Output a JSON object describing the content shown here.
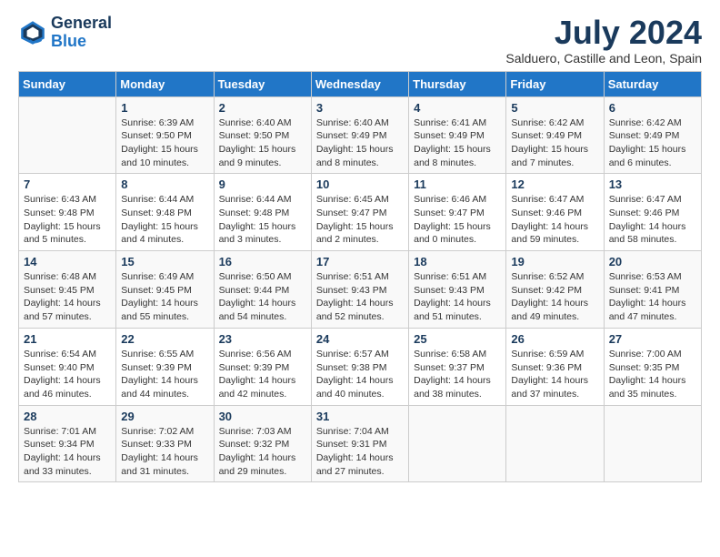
{
  "header": {
    "logo_line1": "General",
    "logo_line2": "Blue",
    "month_title": "July 2024",
    "location": "Salduero, Castille and Leon, Spain"
  },
  "days_of_week": [
    "Sunday",
    "Monday",
    "Tuesday",
    "Wednesday",
    "Thursday",
    "Friday",
    "Saturday"
  ],
  "weeks": [
    [
      {
        "day": "",
        "info": ""
      },
      {
        "day": "1",
        "info": "Sunrise: 6:39 AM\nSunset: 9:50 PM\nDaylight: 15 hours\nand 10 minutes."
      },
      {
        "day": "2",
        "info": "Sunrise: 6:40 AM\nSunset: 9:50 PM\nDaylight: 15 hours\nand 9 minutes."
      },
      {
        "day": "3",
        "info": "Sunrise: 6:40 AM\nSunset: 9:49 PM\nDaylight: 15 hours\nand 8 minutes."
      },
      {
        "day": "4",
        "info": "Sunrise: 6:41 AM\nSunset: 9:49 PM\nDaylight: 15 hours\nand 8 minutes."
      },
      {
        "day": "5",
        "info": "Sunrise: 6:42 AM\nSunset: 9:49 PM\nDaylight: 15 hours\nand 7 minutes."
      },
      {
        "day": "6",
        "info": "Sunrise: 6:42 AM\nSunset: 9:49 PM\nDaylight: 15 hours\nand 6 minutes."
      }
    ],
    [
      {
        "day": "7",
        "info": "Sunrise: 6:43 AM\nSunset: 9:48 PM\nDaylight: 15 hours\nand 5 minutes."
      },
      {
        "day": "8",
        "info": "Sunrise: 6:44 AM\nSunset: 9:48 PM\nDaylight: 15 hours\nand 4 minutes."
      },
      {
        "day": "9",
        "info": "Sunrise: 6:44 AM\nSunset: 9:48 PM\nDaylight: 15 hours\nand 3 minutes."
      },
      {
        "day": "10",
        "info": "Sunrise: 6:45 AM\nSunset: 9:47 PM\nDaylight: 15 hours\nand 2 minutes."
      },
      {
        "day": "11",
        "info": "Sunrise: 6:46 AM\nSunset: 9:47 PM\nDaylight: 15 hours\nand 0 minutes."
      },
      {
        "day": "12",
        "info": "Sunrise: 6:47 AM\nSunset: 9:46 PM\nDaylight: 14 hours\nand 59 minutes."
      },
      {
        "day": "13",
        "info": "Sunrise: 6:47 AM\nSunset: 9:46 PM\nDaylight: 14 hours\nand 58 minutes."
      }
    ],
    [
      {
        "day": "14",
        "info": "Sunrise: 6:48 AM\nSunset: 9:45 PM\nDaylight: 14 hours\nand 57 minutes."
      },
      {
        "day": "15",
        "info": "Sunrise: 6:49 AM\nSunset: 9:45 PM\nDaylight: 14 hours\nand 55 minutes."
      },
      {
        "day": "16",
        "info": "Sunrise: 6:50 AM\nSunset: 9:44 PM\nDaylight: 14 hours\nand 54 minutes."
      },
      {
        "day": "17",
        "info": "Sunrise: 6:51 AM\nSunset: 9:43 PM\nDaylight: 14 hours\nand 52 minutes."
      },
      {
        "day": "18",
        "info": "Sunrise: 6:51 AM\nSunset: 9:43 PM\nDaylight: 14 hours\nand 51 minutes."
      },
      {
        "day": "19",
        "info": "Sunrise: 6:52 AM\nSunset: 9:42 PM\nDaylight: 14 hours\nand 49 minutes."
      },
      {
        "day": "20",
        "info": "Sunrise: 6:53 AM\nSunset: 9:41 PM\nDaylight: 14 hours\nand 47 minutes."
      }
    ],
    [
      {
        "day": "21",
        "info": "Sunrise: 6:54 AM\nSunset: 9:40 PM\nDaylight: 14 hours\nand 46 minutes."
      },
      {
        "day": "22",
        "info": "Sunrise: 6:55 AM\nSunset: 9:39 PM\nDaylight: 14 hours\nand 44 minutes."
      },
      {
        "day": "23",
        "info": "Sunrise: 6:56 AM\nSunset: 9:39 PM\nDaylight: 14 hours\nand 42 minutes."
      },
      {
        "day": "24",
        "info": "Sunrise: 6:57 AM\nSunset: 9:38 PM\nDaylight: 14 hours\nand 40 minutes."
      },
      {
        "day": "25",
        "info": "Sunrise: 6:58 AM\nSunset: 9:37 PM\nDaylight: 14 hours\nand 38 minutes."
      },
      {
        "day": "26",
        "info": "Sunrise: 6:59 AM\nSunset: 9:36 PM\nDaylight: 14 hours\nand 37 minutes."
      },
      {
        "day": "27",
        "info": "Sunrise: 7:00 AM\nSunset: 9:35 PM\nDaylight: 14 hours\nand 35 minutes."
      }
    ],
    [
      {
        "day": "28",
        "info": "Sunrise: 7:01 AM\nSunset: 9:34 PM\nDaylight: 14 hours\nand 33 minutes."
      },
      {
        "day": "29",
        "info": "Sunrise: 7:02 AM\nSunset: 9:33 PM\nDaylight: 14 hours\nand 31 minutes."
      },
      {
        "day": "30",
        "info": "Sunrise: 7:03 AM\nSunset: 9:32 PM\nDaylight: 14 hours\nand 29 minutes."
      },
      {
        "day": "31",
        "info": "Sunrise: 7:04 AM\nSunset: 9:31 PM\nDaylight: 14 hours\nand 27 minutes."
      },
      {
        "day": "",
        "info": ""
      },
      {
        "day": "",
        "info": ""
      },
      {
        "day": "",
        "info": ""
      }
    ]
  ]
}
